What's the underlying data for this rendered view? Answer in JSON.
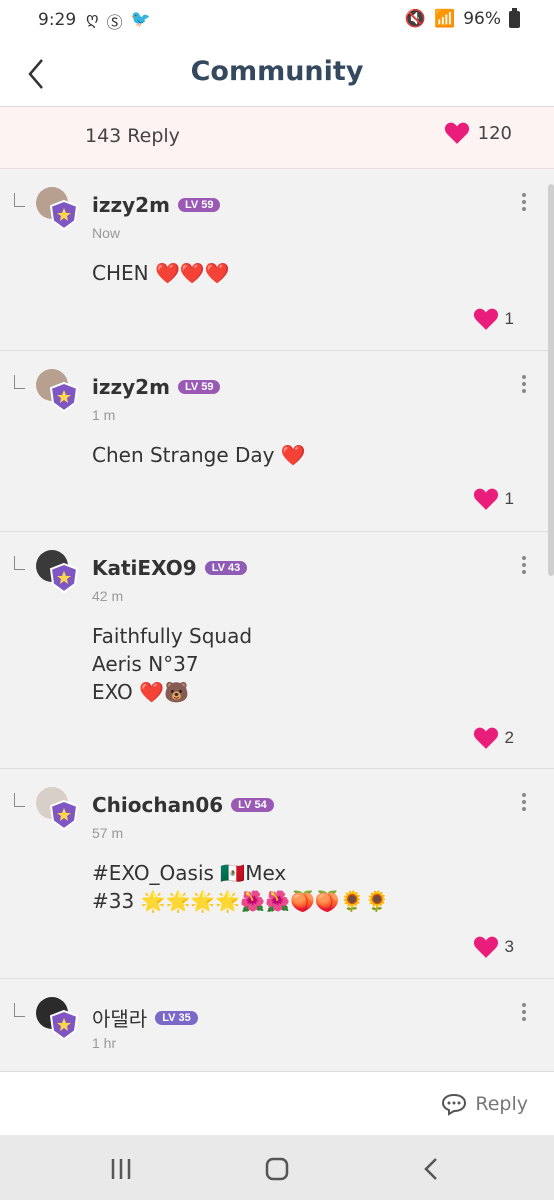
{
  "status_bar": {
    "time": "9:29",
    "battery": "96%"
  },
  "header": {
    "title": "Community"
  },
  "summary": {
    "reply_count": "143 Reply",
    "like_count": "120"
  },
  "comments": [
    {
      "username": "izzy2m",
      "level": "LV 59",
      "time": "Now",
      "text": "CHEN ❤️❤️❤️",
      "likes": "1"
    },
    {
      "username": "izzy2m",
      "level": "LV 59",
      "time": "1 m",
      "text": "Chen Strange Day ❤️",
      "likes": "1"
    },
    {
      "username": "KatiEXO9",
      "level": "LV 43",
      "time": "42 m",
      "text": "Faithfully Squad\nAeris N°37\nEXO ❤️🐻",
      "likes": "2"
    },
    {
      "username": "Chiochan06",
      "level": "LV 54",
      "time": "57 m",
      "text": "#EXO_Oasis 🇲🇽Mex\n#33 🌟🌟🌟🌟🌺🌺🍑🍑🌻🌻",
      "likes": "3"
    },
    {
      "username": "아댈라",
      "level": "LV 35",
      "time": "1 hr",
      "text": "",
      "likes": ""
    }
  ],
  "reply_bar": {
    "label": "Reply"
  },
  "colors": {
    "heart": "#e91e7b",
    "title": "#34495e",
    "level_badge": "#9b59b6",
    "summary_bg": "#fdf3f3"
  },
  "icons": [
    "back-chevron-icon",
    "heart-icon",
    "more-vertical-icon",
    "reply-bubble-icon",
    "recent-apps-icon",
    "home-icon",
    "back-icon"
  ]
}
